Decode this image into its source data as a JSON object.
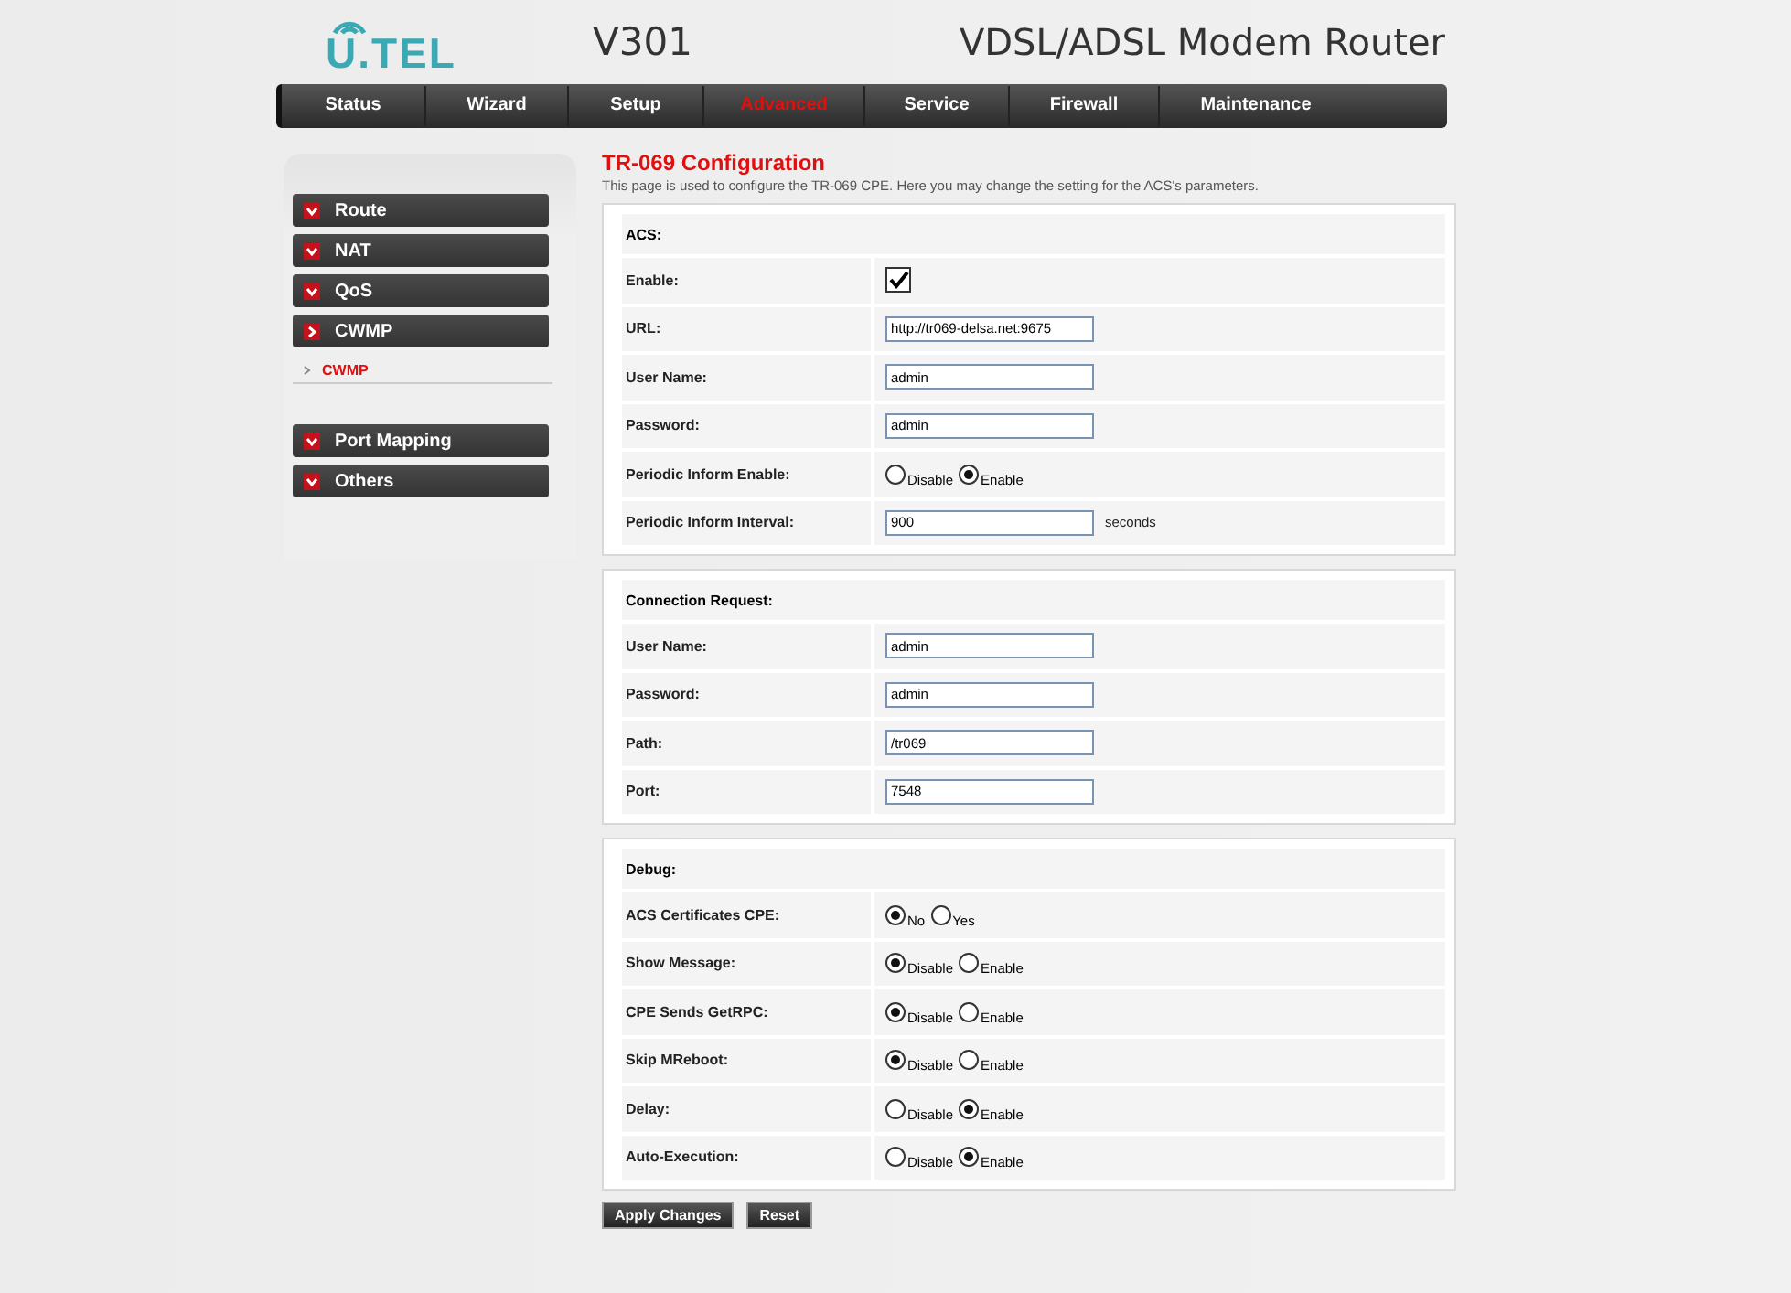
{
  "header": {
    "logo": "U.TEL",
    "model": "V301",
    "product": "VDSL/ADSL Modem Router"
  },
  "tabs": [
    {
      "label": "Status",
      "selected": false
    },
    {
      "label": "Wizard",
      "selected": false
    },
    {
      "label": "Setup",
      "selected": false
    },
    {
      "label": "Advanced",
      "selected": true
    },
    {
      "label": "Service",
      "selected": false
    },
    {
      "label": "Firewall",
      "selected": false
    },
    {
      "label": "Maintenance",
      "selected": false
    }
  ],
  "sidebar": {
    "items": [
      {
        "label": "Route",
        "expanded": false
      },
      {
        "label": "NAT",
        "expanded": false
      },
      {
        "label": "QoS",
        "expanded": false
      },
      {
        "label": "CWMP",
        "expanded": true,
        "children": [
          {
            "label": "CWMP",
            "selected": true
          }
        ]
      },
      {
        "label": "Port Mapping",
        "expanded": false
      },
      {
        "label": "Others",
        "expanded": false
      }
    ]
  },
  "page": {
    "title": "TR-069 Configuration",
    "description": "This page is used to configure the TR-069 CPE. Here you may change the setting for the ACS's parameters."
  },
  "sections": [
    {
      "rows": [
        {
          "kind": "heading",
          "label": "ACS:"
        },
        {
          "kind": "checkbox",
          "label": "Enable:",
          "checked": true
        },
        {
          "kind": "text",
          "label": "URL:",
          "value": "http://tr069-delsa.net:9675"
        },
        {
          "kind": "text",
          "label": "User Name:",
          "value": "admin"
        },
        {
          "kind": "text",
          "label": "Password:",
          "value": "admin"
        },
        {
          "kind": "radio",
          "label": "Periodic Inform Enable:",
          "options": [
            {
              "label": "Disable",
              "selected": false
            },
            {
              "label": "Enable",
              "selected": true
            }
          ]
        },
        {
          "kind": "text",
          "label": "Periodic Inform Interval:",
          "value": "900",
          "unit": "seconds"
        }
      ]
    },
    {
      "rows": [
        {
          "kind": "heading",
          "label": "Connection Request:"
        },
        {
          "kind": "text",
          "label": "User Name:",
          "value": "admin"
        },
        {
          "kind": "text",
          "label": "Password:",
          "value": "admin"
        },
        {
          "kind": "text",
          "label": "Path:",
          "value": "/tr069"
        },
        {
          "kind": "text",
          "label": "Port:",
          "value": "7548"
        }
      ]
    },
    {
      "rows": [
        {
          "kind": "heading",
          "label": "Debug:"
        },
        {
          "kind": "radio",
          "label": "ACS Certificates CPE:",
          "options": [
            {
              "label": "No",
              "selected": true
            },
            {
              "label": "Yes",
              "selected": false
            }
          ]
        },
        {
          "kind": "radio",
          "label": "Show Message:",
          "options": [
            {
              "label": "Disable",
              "selected": true
            },
            {
              "label": "Enable",
              "selected": false
            }
          ]
        },
        {
          "kind": "radio",
          "label": "CPE Sends GetRPC:",
          "options": [
            {
              "label": "Disable",
              "selected": true
            },
            {
              "label": "Enable",
              "selected": false
            }
          ]
        },
        {
          "kind": "radio",
          "label": "Skip MReboot:",
          "options": [
            {
              "label": "Disable",
              "selected": true
            },
            {
              "label": "Enable",
              "selected": false
            }
          ]
        },
        {
          "kind": "radio",
          "label": "Delay:",
          "options": [
            {
              "label": "Disable",
              "selected": false
            },
            {
              "label": "Enable",
              "selected": true
            }
          ]
        },
        {
          "kind": "radio",
          "label": "Auto-Execution:",
          "options": [
            {
              "label": "Disable",
              "selected": false
            },
            {
              "label": "Enable",
              "selected": true
            }
          ]
        }
      ]
    }
  ],
  "buttons": [
    "Apply Changes",
    "Reset"
  ]
}
